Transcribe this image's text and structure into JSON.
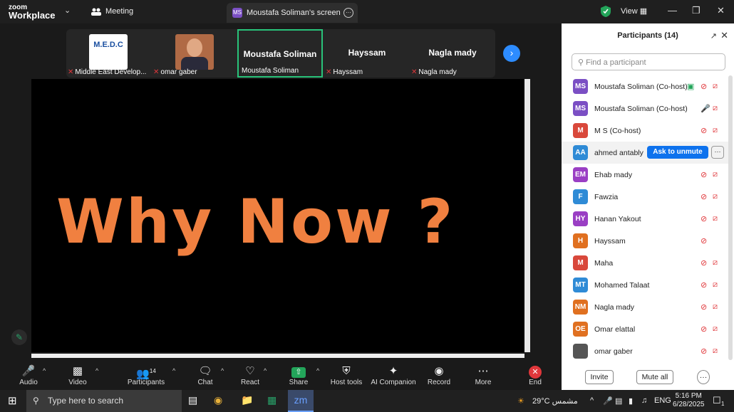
{
  "app": {
    "logo_line1": "zoom",
    "logo_line2": "Workplace",
    "meeting_label": "Meeting",
    "screen_tab_label": "Moustafa Soliman's screen",
    "screen_tab_avatar": "MS",
    "view_label": "View"
  },
  "thumbnails": [
    {
      "name": "Middle East Develop...",
      "image": "medc-logo"
    },
    {
      "name": "omar gaber",
      "image": "photo"
    },
    {
      "name": "Moustafa Soliman",
      "big": "Moustafa Soliman",
      "active": true
    },
    {
      "name": "Hayssam",
      "big": "Hayssam"
    },
    {
      "name": "Nagla mady",
      "big": "Nagla mady"
    }
  ],
  "logo_text": "M.E.D.C",
  "share": {
    "headline": "Why Now ?",
    "headline_color": "#f08040"
  },
  "toolbar": {
    "audio": "Audio",
    "video": "Video",
    "participants": "Participants",
    "participants_count": "14",
    "chat": "Chat",
    "react": "React",
    "share": "Share",
    "host_tools": "Host tools",
    "ai": "AI Companion",
    "record": "Record",
    "more": "More",
    "end": "End"
  },
  "panel": {
    "title": "Participants (14)",
    "search_placeholder": "Find a participant",
    "ask_to_unmute": "Ask to unmute",
    "invite": "Invite",
    "mute_all": "Mute all",
    "participants": [
      {
        "initials": "MS",
        "name": "Moustafa Soliman (Co-host)",
        "color": "#7b4fc4"
      },
      {
        "initials": "MS",
        "name": "Moustafa Soliman (Co-host)",
        "color": "#7b4fc4"
      },
      {
        "initials": "M",
        "name": "M S (Co-host)",
        "color": "#d9483b"
      },
      {
        "initials": "AA",
        "name": "ahmed antably",
        "color": "#2f8bd6"
      },
      {
        "initials": "EM",
        "name": "Ehab mady",
        "color": "#9a3fc4"
      },
      {
        "initials": "F",
        "name": "Fawzia",
        "color": "#2f8bd6"
      },
      {
        "initials": "HY",
        "name": "Hanan Yakout",
        "color": "#9a3fc4"
      },
      {
        "initials": "H",
        "name": "Hayssam",
        "color": "#e07020"
      },
      {
        "initials": "M",
        "name": "Maha",
        "color": "#d9483b"
      },
      {
        "initials": "MT",
        "name": "Mohamed Talaat",
        "color": "#2f8bd6"
      },
      {
        "initials": "NM",
        "name": "Nagla mady",
        "color": "#e07020"
      },
      {
        "initials": "OE",
        "name": "Omar elattal",
        "color": "#e07020"
      },
      {
        "initials": "",
        "name": "omar gaber",
        "color": "#555555"
      }
    ]
  },
  "taskbar": {
    "search": "Type here to search",
    "weather": "29°C مشمس",
    "lang": "ENG",
    "time": "5:16 PM",
    "date": "6/28/2025",
    "notif": "1"
  }
}
